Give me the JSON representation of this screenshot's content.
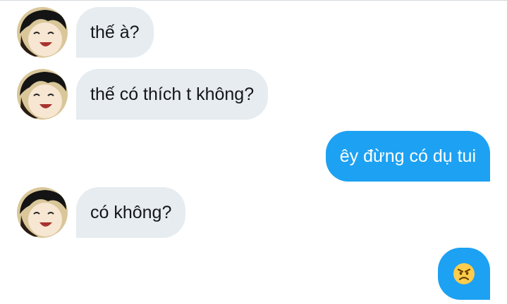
{
  "colors": {
    "incoming_bubble": "#e6ecf0",
    "outgoing_bubble": "#1da1f2",
    "incoming_text": "#14171a",
    "outgoing_text": "#ffffff"
  },
  "conversation": {
    "messages": [
      {
        "direction": "incoming",
        "avatar": "cartoon-avatar-icon",
        "text": "thế à?"
      },
      {
        "direction": "incoming",
        "avatar": "cartoon-avatar-icon",
        "text": "thế có thích t không?"
      },
      {
        "direction": "outgoing",
        "text": "êy đừng có dụ tui"
      },
      {
        "direction": "incoming",
        "avatar": "cartoon-avatar-icon",
        "text": "có không?"
      },
      {
        "direction": "outgoing",
        "emoji": "angry-face-icon"
      }
    ]
  }
}
